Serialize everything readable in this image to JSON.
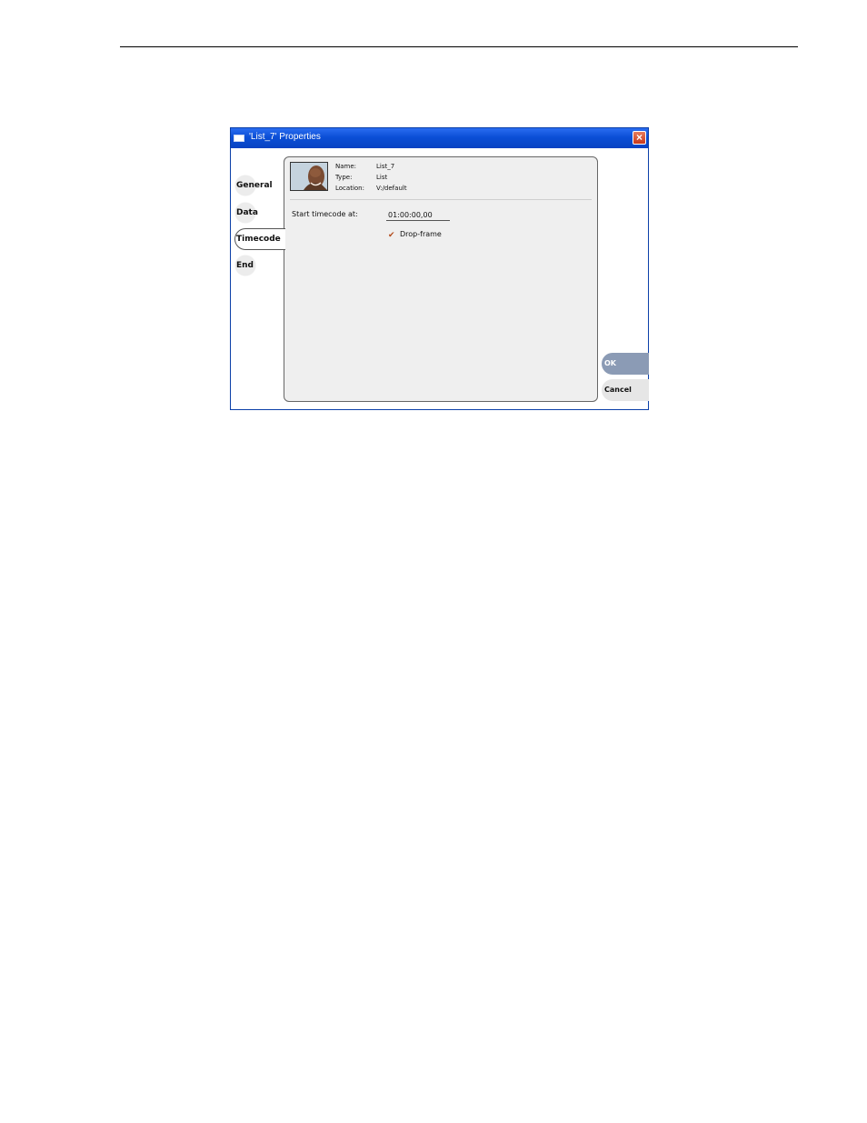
{
  "dialog": {
    "title": "'List_7' Properties"
  },
  "tabs": [
    {
      "label": "General"
    },
    {
      "label": "Data"
    },
    {
      "label": "Timecode"
    },
    {
      "label": "End"
    }
  ],
  "info": {
    "name_label": "Name:",
    "name_value": "List_7",
    "type_label": "Type:",
    "type_value": "List",
    "location_label": "Location:",
    "location_value": "V:/default"
  },
  "timecode": {
    "start_label": "Start timecode at:",
    "start_value": "01:00:00,00",
    "drop_frame_label": "Drop-frame",
    "drop_frame_checked": true
  },
  "buttons": {
    "ok": "OK",
    "cancel": "Cancel"
  },
  "icons": {
    "close": "close-icon",
    "window": "window-icon",
    "check": "check-icon"
  }
}
